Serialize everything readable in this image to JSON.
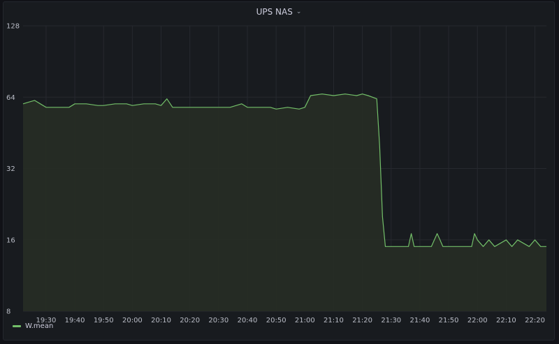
{
  "panel": {
    "title": "UPS NAS"
  },
  "colors": {
    "line": "#73bf69",
    "fill": "#262c25",
    "grid": "#26292f",
    "background": "#181b1f"
  },
  "chart_data": {
    "type": "area",
    "title": "UPS NAS",
    "xlabel": "",
    "ylabel": "",
    "y_scale": "log2",
    "ylim": [
      8,
      128
    ],
    "y_ticks": [
      8,
      16,
      32,
      64,
      128
    ],
    "y_tick_labels": [
      "8",
      "16",
      "32",
      "64",
      "128"
    ],
    "xlim": [
      "19:22",
      "22:24"
    ],
    "x_ticks": [
      "19:30",
      "19:40",
      "19:50",
      "20:00",
      "20:10",
      "20:20",
      "20:30",
      "20:40",
      "20:50",
      "21:00",
      "21:10",
      "21:20",
      "21:30",
      "21:40",
      "21:50",
      "22:00",
      "22:10",
      "22:20"
    ],
    "grid": true,
    "legend": {
      "placement": "bottom-left",
      "entries": [
        "W.mean"
      ]
    },
    "series": [
      {
        "name": "W.mean",
        "x": [
          "19:22",
          "19:24",
          "19:26",
          "19:28",
          "19:30",
          "19:34",
          "19:38",
          "19:40",
          "19:44",
          "19:48",
          "19:50",
          "19:54",
          "19:58",
          "20:00",
          "20:04",
          "20:08",
          "20:10",
          "20:12",
          "20:14",
          "20:18",
          "20:20",
          "20:24",
          "20:28",
          "20:30",
          "20:34",
          "20:38",
          "20:40",
          "20:44",
          "20:48",
          "20:50",
          "20:54",
          "20:58",
          "21:00",
          "21:02",
          "21:06",
          "21:10",
          "21:14",
          "21:18",
          "21:20",
          "21:22",
          "21:25",
          "21:26",
          "21:27",
          "21:28",
          "21:32",
          "21:36",
          "21:37",
          "21:38",
          "21:44",
          "21:46",
          "21:47",
          "21:48",
          "21:58",
          "21:59",
          "22:00",
          "22:02",
          "22:04",
          "22:06",
          "22:10",
          "22:12",
          "22:14",
          "22:18",
          "22:20",
          "22:22",
          "22:24"
        ],
        "values": [
          60,
          61,
          62,
          60,
          58,
          58,
          58,
          60,
          60,
          59,
          59,
          60,
          60,
          59,
          60,
          60,
          59,
          63,
          58,
          58,
          58,
          58,
          58,
          58,
          58,
          60,
          58,
          58,
          58,
          57,
          58,
          57,
          58,
          65,
          66,
          65,
          66,
          65,
          66,
          65,
          63,
          40,
          20,
          15,
          15,
          15,
          17,
          15,
          15,
          17,
          16,
          15,
          15,
          17,
          16,
          15,
          16,
          15,
          16,
          15,
          16,
          15,
          16,
          15,
          15
        ]
      }
    ]
  }
}
